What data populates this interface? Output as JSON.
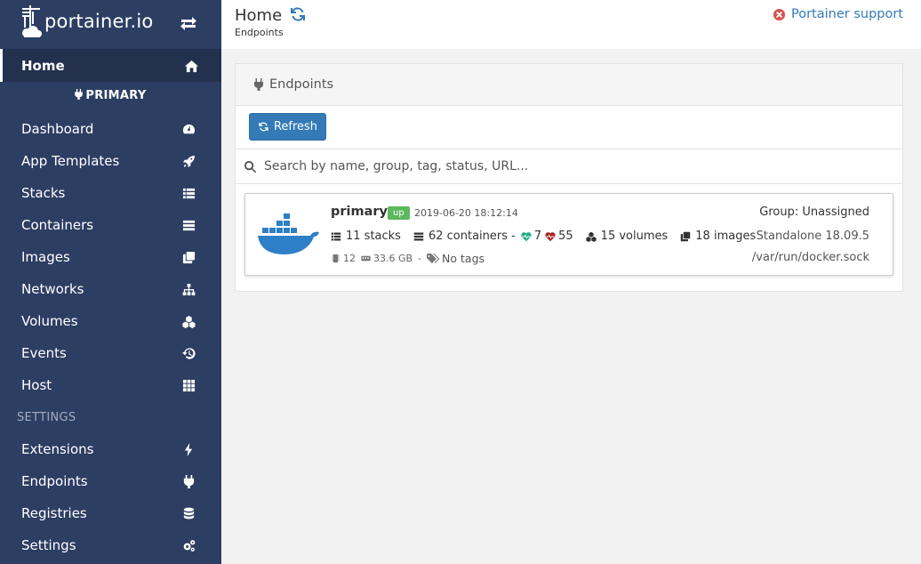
{
  "sidebar": {
    "logo_text": "portainer.io",
    "home_label": "Home",
    "endpoint_name": "PRIMARY",
    "items": [
      {
        "label": "Dashboard",
        "icon": "dashboard-icon"
      },
      {
        "label": "App Templates",
        "icon": "rocket-icon"
      },
      {
        "label": "Stacks",
        "icon": "list-icon"
      },
      {
        "label": "Containers",
        "icon": "server-icon"
      },
      {
        "label": "Images",
        "icon": "clone-icon"
      },
      {
        "label": "Networks",
        "icon": "sitemap-icon"
      },
      {
        "label": "Volumes",
        "icon": "cubes-icon"
      },
      {
        "label": "Events",
        "icon": "history-icon"
      },
      {
        "label": "Host",
        "icon": "th-icon"
      }
    ],
    "settings_section": "SETTINGS",
    "settings_items": [
      {
        "label": "Extensions",
        "icon": "bolt-icon"
      },
      {
        "label": "Endpoints",
        "icon": "plug-icon"
      },
      {
        "label": "Registries",
        "icon": "database-icon"
      },
      {
        "label": "Settings",
        "icon": "cogs-icon"
      }
    ]
  },
  "header": {
    "title": "Home",
    "breadcrumb": "Endpoints",
    "support_label": "Portainer support"
  },
  "widget": {
    "title": "Endpoints",
    "refresh_label": "Refresh",
    "search_placeholder": "Search by name, group, tag, status, URL..."
  },
  "endpoint": {
    "name": "primary",
    "status": "up",
    "timestamp": "2019-06-20 18:12:14",
    "group": "Group: Unassigned",
    "stacks": "11 stacks",
    "containers": "62 containers -",
    "healthy": "7",
    "unhealthy": "55",
    "volumes": "15 volumes",
    "images": "18 images",
    "version": "Standalone 18.09.5",
    "cpu": "12",
    "memory": "33.6 GB",
    "separator": "-",
    "tags": "No tags",
    "url": "/var/run/docker.sock"
  },
  "colors": {
    "sidebar_bg": "#2d3e63",
    "accent": "#337ab7",
    "status_up": "#5cb85c",
    "support_icon": "#d9534f"
  }
}
